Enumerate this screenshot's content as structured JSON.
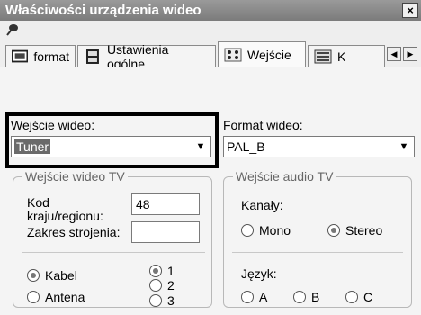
{
  "window": {
    "title": "Właściwości urządzenia wideo",
    "close_label": "×"
  },
  "tabs": [
    {
      "label": "format",
      "icon": "display-icon"
    },
    {
      "label": "Ustawienia ogólne",
      "icon": "film-icon"
    },
    {
      "label": "Wejście",
      "icon": "dots-icon",
      "active": true
    },
    {
      "label": "K",
      "icon": "panel-icon"
    }
  ],
  "scroll": {
    "left": "◀",
    "right": "▶"
  },
  "video_input": {
    "label": "Wejście wideo:",
    "value": "Tuner"
  },
  "video_format": {
    "label": "Format wideo:",
    "value": "PAL_B"
  },
  "tv_video": {
    "title": "Wejście wideo TV",
    "country_code_label_1": "Kod",
    "country_code_label_2": "kraju/regionu:",
    "country_code_value": "48",
    "tuning_range_label": "Zakres strojenia:",
    "tuning_range_value": "",
    "sources": [
      {
        "label": "Kabel",
        "selected": true
      },
      {
        "label": "Antena",
        "selected": false
      }
    ],
    "channels": [
      {
        "label": "1",
        "selected": true
      },
      {
        "label": "2",
        "selected": false
      },
      {
        "label": "3",
        "selected": false
      }
    ]
  },
  "tv_audio": {
    "title": "Wejście audio TV",
    "channels_label": "Kanały:",
    "modes": [
      {
        "label": "Mono",
        "selected": false
      },
      {
        "label": "Stereo",
        "selected": true
      }
    ],
    "language_label": "Język:",
    "languages": [
      {
        "label": "A",
        "selected": false
      },
      {
        "label": "B",
        "selected": false
      },
      {
        "label": "C",
        "selected": false
      }
    ]
  },
  "colors": {
    "titlebar": "#8a8a8a",
    "selection": "#6a6a6a",
    "highlight_border": "#000000"
  }
}
